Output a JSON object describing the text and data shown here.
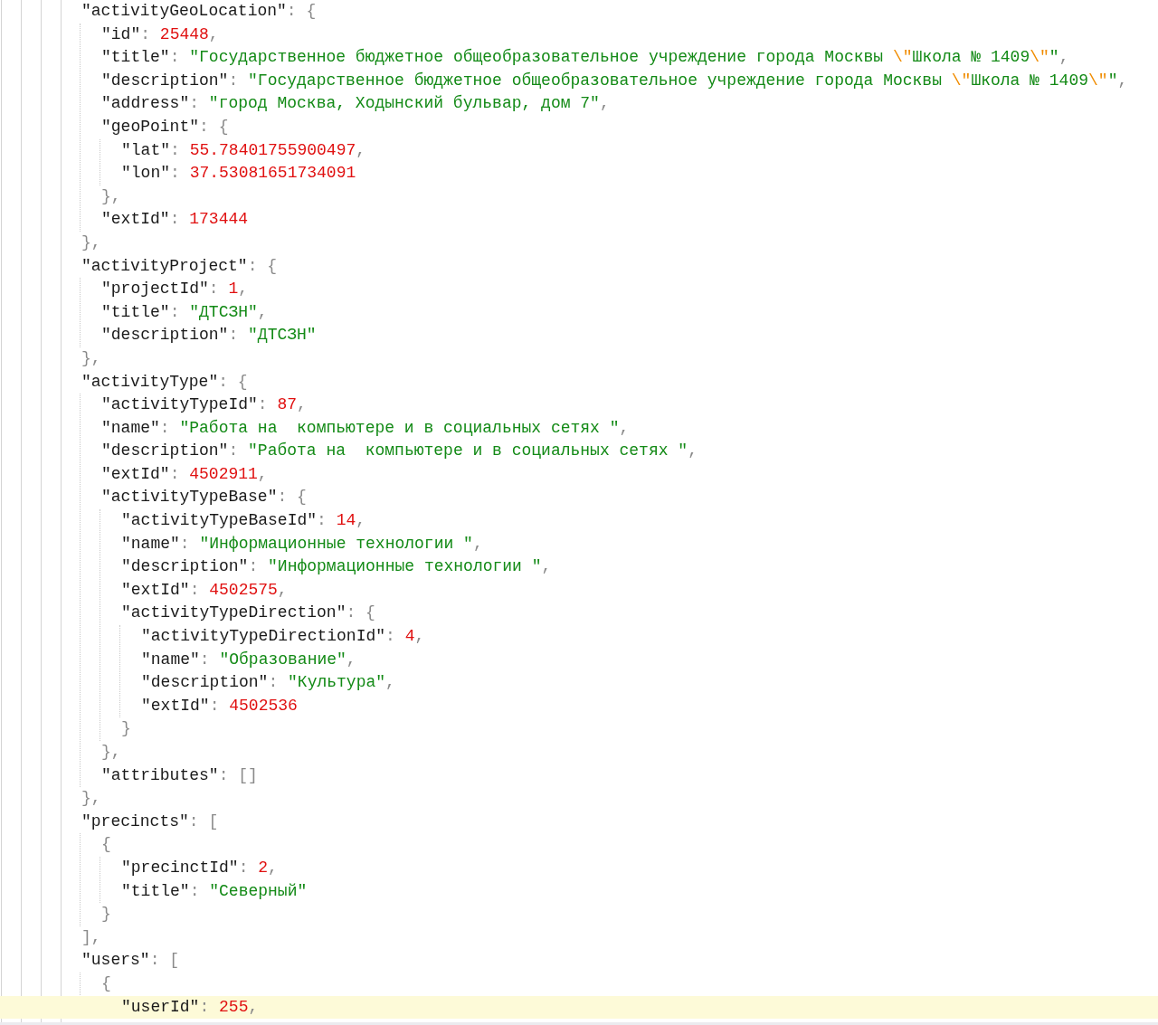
{
  "editor": {
    "lines": [
      {
        "current": false,
        "tokens": [
          {
            "kind": "key",
            "text": "\"activityGeoLocation\""
          },
          {
            "kind": "punct",
            "text": ": {"
          }
        ],
        "children": [
          {
            "current": false,
            "tokens": [
              {
                "kind": "key",
                "text": "\"id\""
              },
              {
                "kind": "punct",
                "text": ": "
              },
              {
                "kind": "number",
                "text": "25448"
              },
              {
                "kind": "punct",
                "text": ","
              }
            ]
          },
          {
            "current": false,
            "tokens": [
              {
                "kind": "key",
                "text": "\"title\""
              },
              {
                "kind": "punct",
                "text": ": "
              },
              {
                "kind": "string",
                "text": "\"Государственное бюджетное общеобразовательное учреждение города Москвы "
              },
              {
                "kind": "escape",
                "text": "\\\""
              },
              {
                "kind": "string",
                "text": "Школа № 1409"
              },
              {
                "kind": "escape",
                "text": "\\\""
              },
              {
                "kind": "string",
                "text": "\""
              },
              {
                "kind": "punct",
                "text": ","
              }
            ]
          },
          {
            "current": false,
            "tokens": [
              {
                "kind": "key",
                "text": "\"description\""
              },
              {
                "kind": "punct",
                "text": ": "
              },
              {
                "kind": "string",
                "text": "\"Государственное бюджетное общеобразовательное учреждение города Москвы "
              },
              {
                "kind": "escape",
                "text": "\\\""
              },
              {
                "kind": "string",
                "text": "Школа № 1409"
              },
              {
                "kind": "escape",
                "text": "\\\""
              },
              {
                "kind": "string",
                "text": "\""
              },
              {
                "kind": "punct",
                "text": ","
              }
            ]
          },
          {
            "current": false,
            "tokens": [
              {
                "kind": "key",
                "text": "\"address\""
              },
              {
                "kind": "punct",
                "text": ": "
              },
              {
                "kind": "string",
                "text": "\"город Москва, Ходынский бульвар, дом 7\""
              },
              {
                "kind": "punct",
                "text": ","
              }
            ]
          },
          {
            "current": false,
            "tokens": [
              {
                "kind": "key",
                "text": "\"geoPoint\""
              },
              {
                "kind": "punct",
                "text": ": {"
              }
            ],
            "children": [
              {
                "current": false,
                "tokens": [
                  {
                    "kind": "key",
                    "text": "\"lat\""
                  },
                  {
                    "kind": "punct",
                    "text": ": "
                  },
                  {
                    "kind": "number",
                    "text": "55.78401755900497"
                  },
                  {
                    "kind": "punct",
                    "text": ","
                  }
                ]
              },
              {
                "current": false,
                "tokens": [
                  {
                    "kind": "key",
                    "text": "\"lon\""
                  },
                  {
                    "kind": "punct",
                    "text": ": "
                  },
                  {
                    "kind": "number",
                    "text": "37.53081651734091"
                  }
                ]
              }
            ]
          },
          {
            "current": false,
            "tokens": [
              {
                "kind": "punct",
                "text": "},"
              }
            ]
          },
          {
            "current": false,
            "tokens": [
              {
                "kind": "key",
                "text": "\"extId\""
              },
              {
                "kind": "punct",
                "text": ": "
              },
              {
                "kind": "number",
                "text": "173444"
              }
            ]
          }
        ]
      },
      {
        "current": false,
        "tokens": [
          {
            "kind": "punct",
            "text": "},"
          }
        ]
      },
      {
        "current": false,
        "tokens": [
          {
            "kind": "key",
            "text": "\"activityProject\""
          },
          {
            "kind": "punct",
            "text": ": {"
          }
        ],
        "children": [
          {
            "current": false,
            "tokens": [
              {
                "kind": "key",
                "text": "\"projectId\""
              },
              {
                "kind": "punct",
                "text": ": "
              },
              {
                "kind": "number",
                "text": "1"
              },
              {
                "kind": "punct",
                "text": ","
              }
            ]
          },
          {
            "current": false,
            "tokens": [
              {
                "kind": "key",
                "text": "\"title\""
              },
              {
                "kind": "punct",
                "text": ": "
              },
              {
                "kind": "string",
                "text": "\"ДТСЗН\""
              },
              {
                "kind": "punct",
                "text": ","
              }
            ]
          },
          {
            "current": false,
            "tokens": [
              {
                "kind": "key",
                "text": "\"description\""
              },
              {
                "kind": "punct",
                "text": ": "
              },
              {
                "kind": "string",
                "text": "\"ДТСЗН\""
              }
            ]
          }
        ]
      },
      {
        "current": false,
        "tokens": [
          {
            "kind": "punct",
            "text": "},"
          }
        ]
      },
      {
        "current": false,
        "tokens": [
          {
            "kind": "key",
            "text": "\"activityType\""
          },
          {
            "kind": "punct",
            "text": ": {"
          }
        ],
        "children": [
          {
            "current": false,
            "tokens": [
              {
                "kind": "key",
                "text": "\"activityTypeId\""
              },
              {
                "kind": "punct",
                "text": ": "
              },
              {
                "kind": "number",
                "text": "87"
              },
              {
                "kind": "punct",
                "text": ","
              }
            ]
          },
          {
            "current": false,
            "tokens": [
              {
                "kind": "key",
                "text": "\"name\""
              },
              {
                "kind": "punct",
                "text": ": "
              },
              {
                "kind": "string",
                "text": "\"Работа на  компьютере и в социальных сетях \""
              },
              {
                "kind": "punct",
                "text": ","
              }
            ]
          },
          {
            "current": false,
            "tokens": [
              {
                "kind": "key",
                "text": "\"description\""
              },
              {
                "kind": "punct",
                "text": ": "
              },
              {
                "kind": "string",
                "text": "\"Работа на  компьютере и в социальных сетях \""
              },
              {
                "kind": "punct",
                "text": ","
              }
            ]
          },
          {
            "current": false,
            "tokens": [
              {
                "kind": "key",
                "text": "\"extId\""
              },
              {
                "kind": "punct",
                "text": ": "
              },
              {
                "kind": "number",
                "text": "4502911"
              },
              {
                "kind": "punct",
                "text": ","
              }
            ]
          },
          {
            "current": false,
            "tokens": [
              {
                "kind": "key",
                "text": "\"activityTypeBase\""
              },
              {
                "kind": "punct",
                "text": ": {"
              }
            ],
            "children": [
              {
                "current": false,
                "tokens": [
                  {
                    "kind": "key",
                    "text": "\"activityTypeBaseId\""
                  },
                  {
                    "kind": "punct",
                    "text": ": "
                  },
                  {
                    "kind": "number",
                    "text": "14"
                  },
                  {
                    "kind": "punct",
                    "text": ","
                  }
                ]
              },
              {
                "current": false,
                "tokens": [
                  {
                    "kind": "key",
                    "text": "\"name\""
                  },
                  {
                    "kind": "punct",
                    "text": ": "
                  },
                  {
                    "kind": "string",
                    "text": "\"Информационные технологии \""
                  },
                  {
                    "kind": "punct",
                    "text": ","
                  }
                ]
              },
              {
                "current": false,
                "tokens": [
                  {
                    "kind": "key",
                    "text": "\"description\""
                  },
                  {
                    "kind": "punct",
                    "text": ": "
                  },
                  {
                    "kind": "string",
                    "text": "\"Информационные технологии \""
                  },
                  {
                    "kind": "punct",
                    "text": ","
                  }
                ]
              },
              {
                "current": false,
                "tokens": [
                  {
                    "kind": "key",
                    "text": "\"extId\""
                  },
                  {
                    "kind": "punct",
                    "text": ": "
                  },
                  {
                    "kind": "number",
                    "text": "4502575"
                  },
                  {
                    "kind": "punct",
                    "text": ","
                  }
                ]
              },
              {
                "current": false,
                "tokens": [
                  {
                    "kind": "key",
                    "text": "\"activityTypeDirection\""
                  },
                  {
                    "kind": "punct",
                    "text": ": {"
                  }
                ],
                "children": [
                  {
                    "current": false,
                    "tokens": [
                      {
                        "kind": "key",
                        "text": "\"activityTypeDirectionId\""
                      },
                      {
                        "kind": "punct",
                        "text": ": "
                      },
                      {
                        "kind": "number",
                        "text": "4"
                      },
                      {
                        "kind": "punct",
                        "text": ","
                      }
                    ]
                  },
                  {
                    "current": false,
                    "tokens": [
                      {
                        "kind": "key",
                        "text": "\"name\""
                      },
                      {
                        "kind": "punct",
                        "text": ": "
                      },
                      {
                        "kind": "string",
                        "text": "\"Образование\""
                      },
                      {
                        "kind": "punct",
                        "text": ","
                      }
                    ]
                  },
                  {
                    "current": false,
                    "tokens": [
                      {
                        "kind": "key",
                        "text": "\"description\""
                      },
                      {
                        "kind": "punct",
                        "text": ": "
                      },
                      {
                        "kind": "string",
                        "text": "\"Культура\""
                      },
                      {
                        "kind": "punct",
                        "text": ","
                      }
                    ]
                  },
                  {
                    "current": false,
                    "tokens": [
                      {
                        "kind": "key",
                        "text": "\"extId\""
                      },
                      {
                        "kind": "punct",
                        "text": ": "
                      },
                      {
                        "kind": "number",
                        "text": "4502536"
                      }
                    ]
                  }
                ]
              },
              {
                "current": false,
                "tokens": [
                  {
                    "kind": "punct",
                    "text": "}"
                  }
                ]
              }
            ]
          },
          {
            "current": false,
            "tokens": [
              {
                "kind": "punct",
                "text": "},"
              }
            ]
          },
          {
            "current": false,
            "tokens": [
              {
                "kind": "key",
                "text": "\"attributes\""
              },
              {
                "kind": "punct",
                "text": ": []"
              }
            ]
          }
        ]
      },
      {
        "current": false,
        "tokens": [
          {
            "kind": "punct",
            "text": "},"
          }
        ]
      },
      {
        "current": false,
        "tokens": [
          {
            "kind": "key",
            "text": "\"precincts\""
          },
          {
            "kind": "punct",
            "text": ": ["
          }
        ],
        "children": [
          {
            "current": false,
            "tokens": [
              {
                "kind": "punct",
                "text": "{"
              }
            ],
            "children": [
              {
                "current": false,
                "tokens": [
                  {
                    "kind": "key",
                    "text": "\"precinctId\""
                  },
                  {
                    "kind": "punct",
                    "text": ": "
                  },
                  {
                    "kind": "number",
                    "text": "2"
                  },
                  {
                    "kind": "punct",
                    "text": ","
                  }
                ]
              },
              {
                "current": false,
                "tokens": [
                  {
                    "kind": "key",
                    "text": "\"title\""
                  },
                  {
                    "kind": "punct",
                    "text": ": "
                  },
                  {
                    "kind": "string",
                    "text": "\"Северный\""
                  }
                ]
              }
            ]
          },
          {
            "current": false,
            "tokens": [
              {
                "kind": "punct",
                "text": "}"
              }
            ]
          }
        ]
      },
      {
        "current": false,
        "tokens": [
          {
            "kind": "punct",
            "text": "],"
          }
        ]
      },
      {
        "current": false,
        "tokens": [
          {
            "kind": "key",
            "text": "\"users\""
          },
          {
            "kind": "punct",
            "text": ": ["
          }
        ],
        "children": [
          {
            "current": false,
            "tokens": [
              {
                "kind": "punct",
                "text": "{"
              }
            ],
            "children": [
              {
                "current": true,
                "tokens": [
                  {
                    "kind": "key",
                    "text": "\"userId\""
                  },
                  {
                    "kind": "punct",
                    "text": ": "
                  },
                  {
                    "kind": "number",
                    "text": "255"
                  },
                  {
                    "kind": "punct",
                    "text": ","
                  }
                ]
              }
            ]
          }
        ]
      }
    ]
  }
}
